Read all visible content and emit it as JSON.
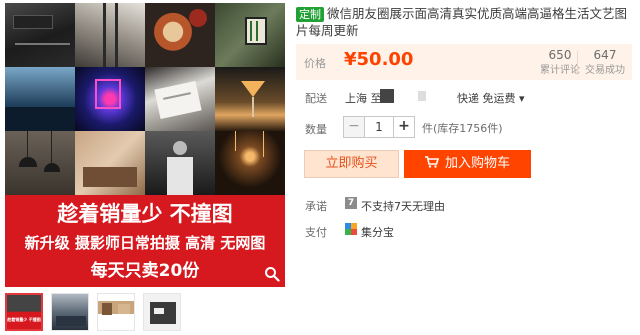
{
  "product": {
    "title": "微信朋友圈展示面高清真实优质高端高逼格生活文艺图片每周更新",
    "custom_tag": "定制"
  },
  "gallery": {
    "promo_line1": "趁着销量少 不撞图",
    "promo_line2": "新升级 摄影师日常拍摄 高清 无网图",
    "promo_line3": "每天只卖20份",
    "thumb_caption": "趁着销量少 不撞图"
  },
  "price": {
    "label": "价格",
    "value": "¥50.00",
    "reviews_count": "650",
    "reviews_label": "累计评论",
    "sales_count": "647",
    "sales_label": "交易成功"
  },
  "shipping": {
    "label": "配送",
    "from": "上海 至",
    "options": "快递 免运费 ▾"
  },
  "quantity": {
    "label": "数量",
    "value": "1",
    "minus": "−",
    "plus": "+",
    "stock_text": "件(库存1756件)"
  },
  "actions": {
    "buy_now": "立即购买",
    "add_to_cart": "加入购物车"
  },
  "promise": {
    "label": "承诺",
    "icon_text": "7",
    "text": "不支持7天无理由"
  },
  "payment": {
    "label": "支付",
    "text": "集分宝"
  },
  "colors": {
    "price": "#ff4200",
    "cart_button": "#ff4400",
    "promo_red": "#d6191f",
    "tag_green": "#20a035"
  }
}
